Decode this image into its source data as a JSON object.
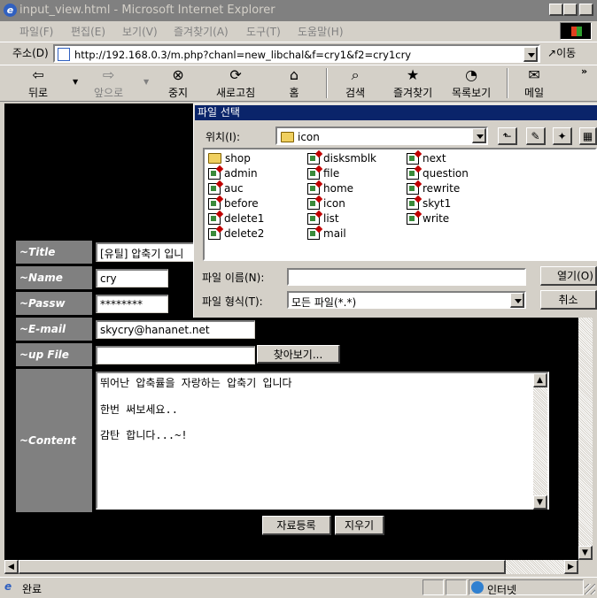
{
  "window": {
    "title": "input_view.html - Microsoft Internet Explorer"
  },
  "menu": [
    "파일(F)",
    "편집(E)",
    "보기(V)",
    "즐겨찾기(A)",
    "도구(T)",
    "도움말(H)"
  ],
  "address": {
    "label": "주소(D)",
    "url": "http://192.168.0.3/m.php?chanl=new_libchal&f=cry1&f2=cry1cry",
    "go": "이동"
  },
  "toolbar": {
    "back": "뒤로",
    "forward": "앞으로",
    "stop": "중지",
    "refresh": "새로고침",
    "home": "홈",
    "search": "검색",
    "favorites": "즐겨찾기",
    "history": "목록보기",
    "mail": "메일"
  },
  "form": {
    "title_label": "~Title",
    "title_value": "[유틸] 압축기 입니",
    "name_label": "~Name",
    "name_value": "cry",
    "passw_label": "~Passw",
    "passw_value": "********",
    "email_label": "~E-mail",
    "email_value": "skycry@hananet.net",
    "file_label": "~up File",
    "file_value": "",
    "browse_button": "찾아보기...",
    "content_label": "~Content",
    "content_lines": [
      "뛰어난 압축률을 자랑하는 압축기 입니다",
      "한번 써보세요..",
      "감탄 합니다...~!"
    ],
    "submit_button": "자료등록",
    "clear_button": "지우기"
  },
  "dialog": {
    "title": "파일 선택",
    "location_label": "위치(I):",
    "location_value": "icon",
    "files": [
      {
        "name": "shop",
        "type": "folder"
      },
      {
        "name": "admin",
        "type": "file"
      },
      {
        "name": "auc",
        "type": "file"
      },
      {
        "name": "before",
        "type": "file"
      },
      {
        "name": "delete1",
        "type": "file"
      },
      {
        "name": "delete2",
        "type": "file"
      },
      {
        "name": "disksmblk",
        "type": "file"
      },
      {
        "name": "file",
        "type": "file"
      },
      {
        "name": "home",
        "type": "file"
      },
      {
        "name": "icon",
        "type": "file"
      },
      {
        "name": "list",
        "type": "file"
      },
      {
        "name": "mail",
        "type": "file"
      },
      {
        "name": "next",
        "type": "file"
      },
      {
        "name": "question",
        "type": "file"
      },
      {
        "name": "rewrite",
        "type": "file"
      },
      {
        "name": "skyt1",
        "type": "file"
      },
      {
        "name": "write",
        "type": "file"
      }
    ],
    "filename_label": "파일 이름(N):",
    "filename_value": "",
    "filetype_label": "파일 형식(T):",
    "filetype_value": "모든 파일(*.*)",
    "open_button": "열기(O)",
    "cancel_button": "취소"
  },
  "status": {
    "text": "완료",
    "zone": "인터넷"
  },
  "colors": {
    "dialog_title_bg": "#0a246a",
    "label_bg": "#808080",
    "page_bg": "#000000"
  }
}
